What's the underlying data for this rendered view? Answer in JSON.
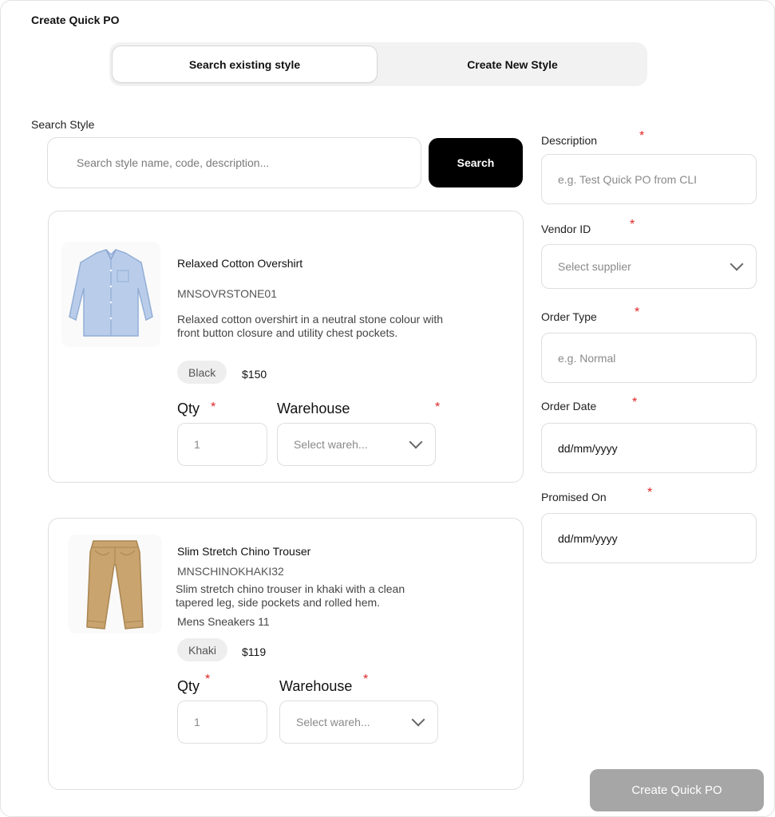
{
  "page": {
    "title": "Create Quick PO"
  },
  "tabs": [
    {
      "label": "Search existing style",
      "active": true
    },
    {
      "label": "Create New Style",
      "active": false
    }
  ],
  "search": {
    "label": "Search Style",
    "placeholder": "Search style name, code, description...",
    "button_label": "Search"
  },
  "products": [
    {
      "name": "Relaxed Cotton Overshirt",
      "code": "MNSOVRSTONE01",
      "description": "Relaxed cotton overshirt in a neutral stone colour with front button closure and utility chest pockets.",
      "extra": "",
      "color": "Black",
      "price": "$150",
      "qty_label": "Qty",
      "qty_placeholder": "1",
      "warehouse_label": "Warehouse",
      "warehouse_placeholder": "Select wareh...",
      "required_mark": "*"
    },
    {
      "name": "Slim Stretch Chino Trouser",
      "code": "MNSCHINOKHAKI32",
      "description": "Slim stretch chino trouser in khaki with a clean tapered leg, side pockets and rolled hem.",
      "extra": "Mens Sneakers 11",
      "color": "Khaki",
      "price": "$119",
      "qty_label": "Qty",
      "qty_placeholder": "1",
      "warehouse_label": "Warehouse",
      "warehouse_placeholder": "Select wareh...",
      "required_mark": "*"
    }
  ],
  "form": {
    "description": {
      "label": "Description",
      "placeholder": "e.g. Test Quick PO from CLI"
    },
    "vendor": {
      "label": "Vendor ID",
      "placeholder": "Select supplier"
    },
    "order_type": {
      "label": "Order Type",
      "placeholder": "e.g. Normal"
    },
    "order_date": {
      "label": "Order Date",
      "value": "dd/mm/yyyy"
    },
    "promised_on": {
      "label": "Promised On",
      "value": "dd/mm/yyyy"
    },
    "required_mark": "*"
  },
  "actions": {
    "create_label": "Create Quick PO"
  },
  "colors": {
    "accent": "#000000",
    "required": "#e02424",
    "disabled_button": "#a6a6a6",
    "shirt": "#b9cdea",
    "chino": "#c9a46f"
  },
  "icons": {
    "dropdown": "chevron-down-icon"
  }
}
